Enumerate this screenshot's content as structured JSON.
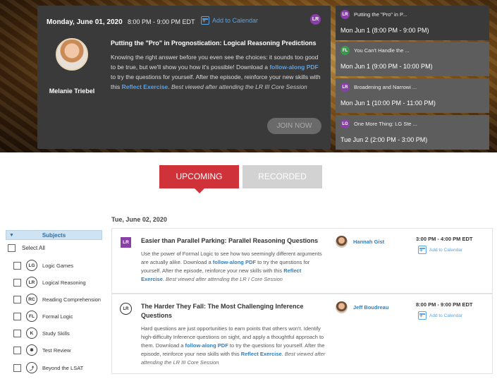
{
  "featured": {
    "date": "Monday, June 01, 2020",
    "time": "8:00 PM - 9:00 PM EDT",
    "add_to_calendar": "Add to Calendar",
    "subject_badge": "LR",
    "instructor": "Melanie Triebel",
    "title": "Putting the \"Pro\" in Prognostication: Logical Reasoning Predictions",
    "desc_1": "Knowing the right answer before you even see the choices: it sounds too good to be true, but we'll show you how it's possible! Download a ",
    "desc_link_1": "follow-along PDF",
    "desc_2": " to try the questions for yourself. After the episode, reinforce your new skills with this ",
    "desc_link_2": "Reflect Exercise",
    "desc_3": ". ",
    "desc_note": "Best viewed after attending the LR III Core Session",
    "join_label": "JOIN NOW"
  },
  "side_sessions": [
    {
      "badge": "LR",
      "badge_color": "#8a3fa8",
      "title": "Putting the \"Pro\" in P...",
      "datetime": "Mon Jun 1 (8:00 PM - 9:00 PM)"
    },
    {
      "badge": "FL",
      "badge_color": "#3a9a4a",
      "title": "You Can't Handle the ...",
      "datetime": "Mon Jun 1 (9:00 PM - 10:00 PM)"
    },
    {
      "badge": "LR",
      "badge_color": "#8a3fa8",
      "title": "Broadening and Narrowi ...",
      "datetime": "Mon Jun 1 (10:00 PM - 11:00 PM)"
    },
    {
      "badge": "LG",
      "badge_color": "#8a3fa8",
      "title": "One More Thing: LG Ste ...",
      "datetime": "Tue Jun 2 (2:00 PM - 3:00 PM)"
    }
  ],
  "tabs": {
    "upcoming": "UPCOMING",
    "recorded": "RECORDED"
  },
  "filters": {
    "header": "Subjects",
    "select_all": "Select All",
    "items": [
      {
        "icon": "LG",
        "label": "Logic Games"
      },
      {
        "icon": "LR",
        "label": "Logical Reasoning"
      },
      {
        "icon": "RC",
        "label": "Reading Comprehension"
      },
      {
        "icon": "FL",
        "label": "Formal Logic"
      },
      {
        "icon": "K",
        "label": "Study Skills"
      },
      {
        "icon": "✱",
        "label": "Test Review"
      },
      {
        "icon": "⤴",
        "label": "Beyond the LSAT"
      }
    ]
  },
  "list": {
    "date": "Tue, June 02, 2020",
    "cards": [
      {
        "badge": "LR",
        "title": "Easier than Parallel Parking: Parallel Reasoning Questions",
        "desc_1": "Use the power of Formal Logic to see how two seemingly different arguments are actually alike. Download a ",
        "desc_link_1": "follow-along PDF",
        "desc_2": " to try the questions for yourself. After the episode, reinforce your new skills with this ",
        "desc_link_2": "Reflect Exercise",
        "desc_3": ". ",
        "desc_note": "Best viewed after attending the LR I Core Session",
        "instructor": "Hannah Gist",
        "time": "3:00 PM - 4:00 PM EDT",
        "add_to_calendar": "Add to Calendar"
      },
      {
        "badge": "LR",
        "title": "The Harder They Fall: The Most Challenging Inference Questions",
        "desc_1": "Hard questions are just opportunities to earn points that others won't. Identify high-difficulty Inference questions on sight, and apply a thoughtful approach to them. Download a ",
        "desc_link_1": "follow-along PDF",
        "desc_2": " to try the questions for yourself. After the episode, reinforce your new skills with this ",
        "desc_link_2": "Reflect Exercise",
        "desc_3": ". ",
        "desc_note": "Best viewed after attending the LR III Core Session",
        "instructor": "Jeff Boudreau",
        "time": "8:00 PM - 9:00 PM EDT",
        "add_to_calendar": "Add to Calendar"
      }
    ]
  }
}
